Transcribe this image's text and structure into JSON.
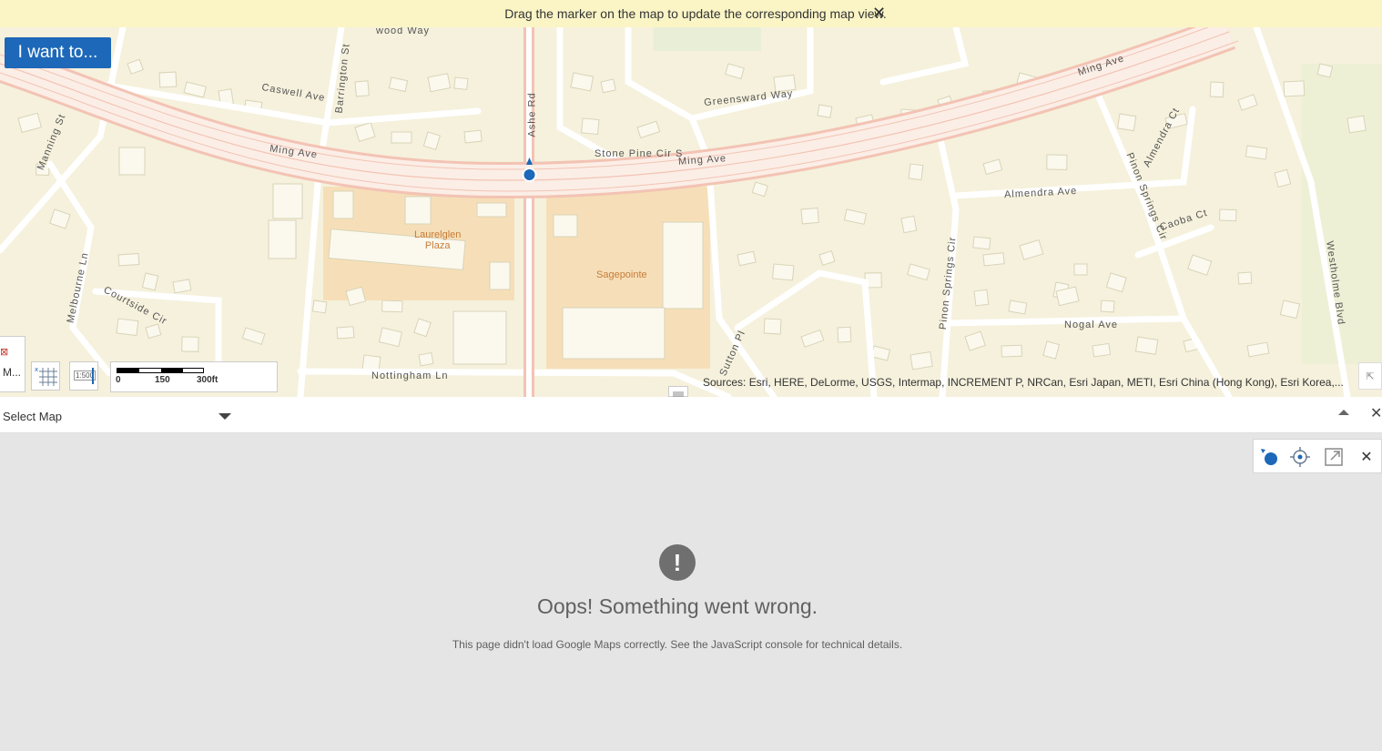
{
  "banner": {
    "message": "Drag the marker on the map to update the corresponding map view.",
    "close": "✕"
  },
  "map": {
    "i_want_to": "I want to...",
    "streets": {
      "caswell": "Caswell Ave",
      "barrington": "Barrington St",
      "ashe": "Ashe Rd",
      "manning": "Manning St",
      "ming_left": "Ming Ave",
      "ming_mid": "Ming Ave",
      "ming_right": "Ming Ave",
      "greensward": "Greensward Way",
      "stone_pine": "Stone Pine Cir S",
      "almendra_ave": "Almendra Ave",
      "almendra_ct": "Almendra Ct",
      "pinon_springs_cir": "Pinon Springs Cir",
      "caoba": "Caoba Ct",
      "melbourne": "Melbourne Ln",
      "courtside": "Courtside Cir",
      "pinon_springs_cir2": "Pinon Springs Cir",
      "nogal": "Nogal Ave",
      "westholme": "Westholme Blvd",
      "sutton": "Sutton Pl",
      "nottingham": "Nottingham Ln",
      "top_way": "wood Way"
    },
    "pois": {
      "laurelglen": "Laurelglen\nPlaza",
      "sagepointe": "Sagepointe"
    },
    "left_tab_label": "M...",
    "scale": {
      "labels": [
        "0",
        "150",
        "300ft"
      ]
    },
    "tool_ratio_label": "1:500",
    "attribution": "Sources: Esri, HERE, DeLorme, USGS, Intermap, INCREMENT P, NRCan, Esri Japan, METI, Esri China (Hong Kong), Esri Korea,..."
  },
  "select_map": {
    "label": "Select Map"
  },
  "error": {
    "icon": "!",
    "title": "Oops! Something went wrong.",
    "description": "This page didn't load Google Maps correctly. See the JavaScript console for technical details."
  },
  "colors": {
    "accent": "#1d68b8",
    "banner_bg": "#fbf5c6",
    "map_bg": "#f5f1dc",
    "road_pink": "#f0b7a8"
  }
}
